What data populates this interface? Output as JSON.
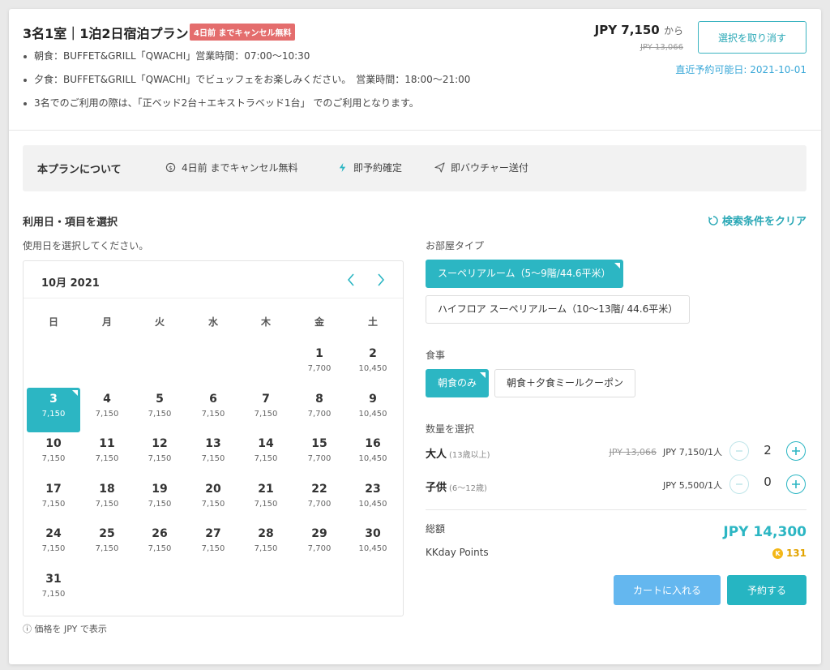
{
  "plan": {
    "title": "3名1室｜1泊2日宿泊プラン",
    "cancel_badge": "4日前 までキャンセル無料",
    "bullets": [
      "朝食：BUFFET&GRILL「QWACHI」営業時間：07:00～10:30",
      "夕食：BUFFET&GRILL「QWACHI」でビュッフェをお楽しみください。　営業時間：18:00～21:00",
      "3名でのご利用の際は、「正ベッド2台＋エキストラベッド1台」 でのご利用となります。"
    ],
    "price": "JPY 7,150",
    "price_suffix": "から",
    "original_price": "JPY 13,066",
    "deselect_label": "選択を取り消す",
    "nearest_date": "直近予約可能日: 2021-10-01"
  },
  "about": {
    "title": "本プランについて",
    "items": [
      {
        "icon": "cancel-free-icon",
        "label": "4日前 までキャンセル無料"
      },
      {
        "icon": "lightning-icon",
        "label": "即予約確定"
      },
      {
        "icon": "send-icon",
        "label": "即バウチャー送付"
      }
    ]
  },
  "selection": {
    "title": "利用日・項目を選択",
    "clear_label": "検索条件をクリア",
    "date_hint": "使用日を選択してください。"
  },
  "calendar": {
    "month": "10月 2021",
    "weekdays": [
      "日",
      "月",
      "火",
      "水",
      "木",
      "金",
      "土"
    ],
    "first_weekday_index": 5,
    "selected_day": 3,
    "days": [
      {
        "d": "1",
        "p": "7,700"
      },
      {
        "d": "2",
        "p": "10,450"
      },
      {
        "d": "3",
        "p": "7,150"
      },
      {
        "d": "4",
        "p": "7,150"
      },
      {
        "d": "5",
        "p": "7,150"
      },
      {
        "d": "6",
        "p": "7,150"
      },
      {
        "d": "7",
        "p": "7,150"
      },
      {
        "d": "8",
        "p": "7,700"
      },
      {
        "d": "9",
        "p": "10,450"
      },
      {
        "d": "10",
        "p": "7,150"
      },
      {
        "d": "11",
        "p": "7,150"
      },
      {
        "d": "12",
        "p": "7,150"
      },
      {
        "d": "13",
        "p": "7,150"
      },
      {
        "d": "14",
        "p": "7,150"
      },
      {
        "d": "15",
        "p": "7,700"
      },
      {
        "d": "16",
        "p": "10,450"
      },
      {
        "d": "17",
        "p": "7,150"
      },
      {
        "d": "18",
        "p": "7,150"
      },
      {
        "d": "19",
        "p": "7,150"
      },
      {
        "d": "20",
        "p": "7,150"
      },
      {
        "d": "21",
        "p": "7,150"
      },
      {
        "d": "22",
        "p": "7,700"
      },
      {
        "d": "23",
        "p": "10,450"
      },
      {
        "d": "24",
        "p": "7,150"
      },
      {
        "d": "25",
        "p": "7,150"
      },
      {
        "d": "26",
        "p": "7,150"
      },
      {
        "d": "27",
        "p": "7,150"
      },
      {
        "d": "28",
        "p": "7,150"
      },
      {
        "d": "29",
        "p": "7,700"
      },
      {
        "d": "30",
        "p": "10,450"
      },
      {
        "d": "31",
        "p": "7,150"
      }
    ],
    "currency_note": "ⓘ 価格を JPY で表示"
  },
  "room": {
    "label": "お部屋タイプ",
    "options": [
      "スーペリアルーム（5～9階/44.6平米）",
      "ハイフロア スーペリアルーム（10～13階/ 44.6平米）"
    ],
    "selected_index": 0
  },
  "meal": {
    "label": "食事",
    "options": [
      "朝食のみ",
      "朝食＋夕食ミールクーポン"
    ],
    "selected_index": 0
  },
  "quantity": {
    "label": "数量を選択",
    "adult": {
      "label": "大人",
      "note": "(13歳以上)",
      "old_price": "JPY 13,066",
      "unit_price": "JPY 7,150/1人",
      "count": "2"
    },
    "child": {
      "label": "子供",
      "note": "(6～12歳)",
      "unit_price": "JPY 5,500/1人",
      "count": "0"
    }
  },
  "summary": {
    "total_label": "総額",
    "total_value": "JPY 14,300",
    "points_label": "KKday Points",
    "points_value": "131"
  },
  "actions": {
    "cart_label": "カートに入れる",
    "book_label": "予約する"
  },
  "colors": {
    "accent": "#2cb6c3",
    "badge": "#e46d6d",
    "cart": "#64b7ef",
    "link": "#3aa8d8"
  }
}
